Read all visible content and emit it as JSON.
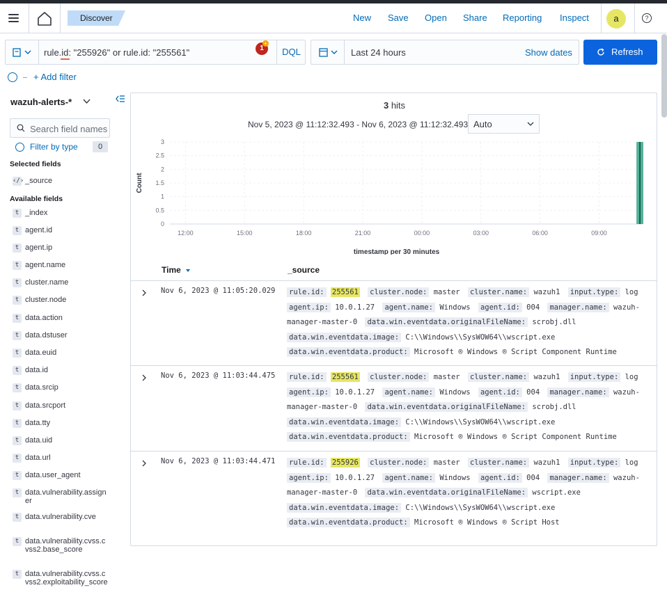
{
  "header": {
    "breadcrumb": "Discover",
    "links": [
      "New",
      "Save",
      "Open",
      "Share",
      "Reporting",
      "Inspect"
    ],
    "avatar": "a",
    "help": "?"
  },
  "query": {
    "text": "rule.id: \"255926\" or rule.id: \"255561\"",
    "notification_count": "1",
    "language": "DQL"
  },
  "date": {
    "label": "Last 24 hours",
    "show_dates": "Show dates",
    "refresh": "Refresh"
  },
  "filter": {
    "add_label": "+ Add filter"
  },
  "sidebar": {
    "index_pattern": "wazuh-alerts-*",
    "search_placeholder": "Search field names",
    "filter_by_type": "Filter by type",
    "filter_count": "0",
    "selected_title": "Selected fields",
    "selected_fields": [
      "_source"
    ],
    "available_title": "Available fields",
    "available_fields": [
      "_index",
      "agent.id",
      "agent.ip",
      "agent.name",
      "cluster.name",
      "cluster.node",
      "data.action",
      "data.dstuser",
      "data.euid",
      "data.id",
      "data.srcip",
      "data.srcport",
      "data.tty",
      "data.uid",
      "data.url",
      "data.user_agent",
      "data.vulnerability.assigner",
      "data.vulnerability.cve",
      "data.vulnerability.cvss.cvss2.base_score",
      "data.vulnerability.cvss.cvss2.exploitability_score"
    ]
  },
  "results": {
    "hits_count": "3",
    "hits_label": "hits",
    "range": "Nov 5, 2023 @ 11:12:32.493 - Nov 6, 2023 @ 11:12:32.493",
    "interval": "Auto",
    "columns": {
      "time": "Time",
      "source": "_source"
    },
    "rows": [
      {
        "time": "Nov 6, 2023 @ 11:05:20.029",
        "fields": [
          [
            "rule.id:",
            "255561",
            true
          ],
          [
            "cluster.node:",
            "master",
            false
          ],
          [
            "cluster.name:",
            "wazuh1",
            false
          ],
          [
            "input.type:",
            "log",
            false
          ],
          [
            "agent.ip:",
            "10.0.1.27",
            false
          ],
          [
            "agent.name:",
            "Windows",
            false
          ],
          [
            "agent.id:",
            "004",
            false
          ],
          [
            "manager.name:",
            "wazuh-manager-master-0",
            false
          ],
          [
            "data.win.eventdata.originalFileName:",
            "scrobj.dll",
            false
          ],
          [
            "data.win.eventdata.image:",
            "C:\\\\Windows\\\\SysWOW64\\\\wscript.exe",
            false
          ],
          [
            "data.win.eventdata.product:",
            "Microsoft ® Windows ® Script Component Runtime",
            false
          ]
        ]
      },
      {
        "time": "Nov 6, 2023 @ 11:03:44.475",
        "fields": [
          [
            "rule.id:",
            "255561",
            true
          ],
          [
            "cluster.node:",
            "master",
            false
          ],
          [
            "cluster.name:",
            "wazuh1",
            false
          ],
          [
            "input.type:",
            "log",
            false
          ],
          [
            "agent.ip:",
            "10.0.1.27",
            false
          ],
          [
            "agent.name:",
            "Windows",
            false
          ],
          [
            "agent.id:",
            "004",
            false
          ],
          [
            "manager.name:",
            "wazuh-manager-master-0",
            false
          ],
          [
            "data.win.eventdata.originalFileName:",
            "scrobj.dll",
            false
          ],
          [
            "data.win.eventdata.image:",
            "C:\\\\Windows\\\\SysWOW64\\\\wscript.exe",
            false
          ],
          [
            "data.win.eventdata.product:",
            "Microsoft ® Windows ® Script Component Runtime",
            false
          ]
        ]
      },
      {
        "time": "Nov 6, 2023 @ 11:03:44.471",
        "fields": [
          [
            "rule.id:",
            "255926",
            true
          ],
          [
            "cluster.node:",
            "master",
            false
          ],
          [
            "cluster.name:",
            "wazuh1",
            false
          ],
          [
            "input.type:",
            "log",
            false
          ],
          [
            "agent.ip:",
            "10.0.1.27",
            false
          ],
          [
            "agent.name:",
            "Windows",
            false
          ],
          [
            "agent.id:",
            "004",
            false
          ],
          [
            "manager.name:",
            "wazuh-manager-master-0",
            false
          ],
          [
            "data.win.eventdata.originalFileName:",
            "wscript.exe",
            false
          ],
          [
            "data.win.eventdata.image:",
            "C:\\\\Windows\\\\SysWOW64\\\\wscript.exe",
            false
          ],
          [
            "data.win.eventdata.product:",
            "Microsoft ® Windows ® Script Host",
            false
          ]
        ]
      }
    ]
  },
  "chart_data": {
    "type": "bar",
    "title": "",
    "xlabel": "timestamp per 30 minutes",
    "ylabel": "Count",
    "x_ticks": [
      "12:00",
      "15:00",
      "18:00",
      "21:00",
      "00:00",
      "03:00",
      "06:00",
      "09:00"
    ],
    "y_ticks": [
      "0",
      "0.5",
      "1",
      "1.5",
      "2",
      "2.5",
      "3"
    ],
    "ylim": [
      0,
      3
    ],
    "xlim": [
      "Nov 5, 2023 11:12:32.493",
      "Nov 6, 2023 11:12:32.493"
    ],
    "grid": true,
    "bars": [
      {
        "x": "Nov 6, 2023 11:00",
        "value": 3
      }
    ],
    "bar_color": "#54b399",
    "highlight_color": "#1a5c4c"
  }
}
